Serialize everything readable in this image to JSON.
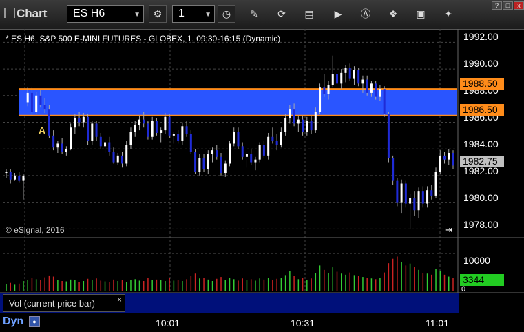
{
  "toolbar": {
    "app_title": "Chart",
    "symbol": "ES H6",
    "interval": "1"
  },
  "chart": {
    "title": "* ES H6, S&P 500 E-MINI FUTURES - GLOBEX, 1, 09:30-16:15 (Dynamic)",
    "copyright": "© eSignal, 2016",
    "marker_letter": "A",
    "price_ticks": [
      "1992.00",
      "1990.00",
      "1988.00",
      "1986.00",
      "1984.00",
      "1982.00",
      "1980.00",
      "1978.00"
    ],
    "zone_top_label": "1988.50",
    "zone_bottom_label": "1986.50",
    "last_price_label": "1982.75",
    "volume_tick": "10000",
    "volume_zero": "0",
    "last_volume_label": "3344",
    "time_labels": [
      "10:01",
      "10:31",
      "11:01"
    ],
    "colors": {
      "zone_fill": "#2a55ff",
      "zone_line": "#ff8c1a",
      "up_candle": "#ffffff",
      "down_candle": "#1f2bd6",
      "vol_up": "#33cc33",
      "vol_down": "#cc2222",
      "last_volume_tag": "#22cc22",
      "last_price_tag": "#c0c0c0"
    }
  },
  "study": {
    "label": "Vol (current price bar)"
  },
  "statusbar": {
    "dyn_label": "Dyn"
  },
  "chart_data": {
    "type": "candlestick",
    "y_range": [
      1977.5,
      1993
    ],
    "zone": [
      1986.5,
      1988.5
    ],
    "candles": [
      [
        1982.2,
        1982.5,
        1981.8,
        1982.3
      ],
      [
        1982.3,
        1982.5,
        1981.4,
        1981.7
      ],
      [
        1981.7,
        1982.2,
        1981.6,
        1982.0
      ],
      [
        1982.0,
        1982.3,
        1981.5,
        1981.6
      ],
      [
        1981.6,
        1982.1,
        1980.2,
        1982.0
      ],
      [
        1987.5,
        1988.6,
        1987.2,
        1988.2
      ],
      [
        1988.2,
        1988.6,
        1986.5,
        1986.8
      ],
      [
        1986.8,
        1988.3,
        1986.6,
        1988.0
      ],
      [
        1988.0,
        1988.4,
        1987.1,
        1987.3
      ],
      [
        1987.3,
        1987.8,
        1986.7,
        1987.0
      ],
      [
        1987.0,
        1987.3,
        1984.8,
        1985.0
      ],
      [
        1985.0,
        1985.4,
        1983.9,
        1984.1
      ],
      [
        1984.1,
        1984.6,
        1983.7,
        1984.4
      ],
      [
        1984.4,
        1984.8,
        1983.6,
        1983.8
      ],
      [
        1983.8,
        1984.2,
        1983.5,
        1984.0
      ],
      [
        1984.0,
        1985.9,
        1983.9,
        1985.6
      ],
      [
        1985.6,
        1986.6,
        1985.1,
        1986.3
      ],
      [
        1986.3,
        1986.8,
        1985.7,
        1986.0
      ],
      [
        1986.0,
        1986.7,
        1985.6,
        1986.4
      ],
      [
        1986.4,
        1986.6,
        1984.3,
        1984.6
      ],
      [
        1984.6,
        1986.1,
        1984.3,
        1985.9
      ],
      [
        1985.9,
        1986.1,
        1984.6,
        1984.9
      ],
      [
        1984.9,
        1985.2,
        1984.0,
        1984.2
      ],
      [
        1984.2,
        1984.7,
        1983.7,
        1984.5
      ],
      [
        1984.5,
        1984.9,
        1983.5,
        1983.8
      ],
      [
        1983.8,
        1984.1,
        1982.9,
        1983.0
      ],
      [
        1983.0,
        1983.7,
        1982.8,
        1983.5
      ],
      [
        1983.5,
        1983.8,
        1982.6,
        1982.9
      ],
      [
        1982.9,
        1984.6,
        1982.7,
        1984.3
      ],
      [
        1984.3,
        1985.6,
        1984.0,
        1985.3
      ],
      [
        1985.3,
        1986.1,
        1984.9,
        1985.8
      ],
      [
        1985.8,
        1986.5,
        1985.4,
        1986.2
      ],
      [
        1986.2,
        1986.8,
        1985.6,
        1985.9
      ],
      [
        1985.9,
        1986.1,
        1984.7,
        1984.9
      ],
      [
        1984.9,
        1986.4,
        1984.7,
        1986.1
      ],
      [
        1986.1,
        1986.3,
        1985.0,
        1985.2
      ],
      [
        1985.2,
        1985.6,
        1984.5,
        1985.4
      ],
      [
        1985.4,
        1986.7,
        1985.1,
        1986.4
      ],
      [
        1986.4,
        1986.6,
        1984.8,
        1985.0
      ],
      [
        1985.0,
        1985.3,
        1984.4,
        1985.1
      ],
      [
        1985.1,
        1985.4,
        1984.4,
        1984.6
      ],
      [
        1984.6,
        1986.0,
        1984.3,
        1985.7
      ],
      [
        1985.7,
        1986.1,
        1984.9,
        1985.1
      ],
      [
        1985.1,
        1985.4,
        1983.6,
        1983.8
      ],
      [
        1983.8,
        1984.0,
        1982.1,
        1982.3
      ],
      [
        1982.3,
        1983.6,
        1982.0,
        1983.3
      ],
      [
        1983.3,
        1983.6,
        1982.3,
        1982.5
      ],
      [
        1982.5,
        1983.9,
        1982.1,
        1983.6
      ],
      [
        1983.6,
        1984.1,
        1983.0,
        1983.9
      ],
      [
        1983.9,
        1984.3,
        1983.2,
        1983.4
      ],
      [
        1983.4,
        1983.7,
        1982.0,
        1982.2
      ],
      [
        1982.2,
        1983.1,
        1981.9,
        1982.9
      ],
      [
        1982.9,
        1984.6,
        1982.7,
        1984.4
      ],
      [
        1984.4,
        1985.6,
        1984.2,
        1985.3
      ],
      [
        1985.3,
        1985.6,
        1984.0,
        1984.2
      ],
      [
        1984.2,
        1984.5,
        1983.2,
        1983.4
      ],
      [
        1983.4,
        1983.8,
        1982.6,
        1983.6
      ],
      [
        1983.6,
        1984.0,
        1982.8,
        1983.0
      ],
      [
        1983.0,
        1983.4,
        1982.4,
        1983.2
      ],
      [
        1983.2,
        1984.5,
        1983.0,
        1984.3
      ],
      [
        1984.3,
        1984.6,
        1983.3,
        1983.5
      ],
      [
        1983.5,
        1985.2,
        1983.2,
        1984.9
      ],
      [
        1984.9,
        1985.6,
        1984.4,
        1984.6
      ],
      [
        1984.6,
        1985.1,
        1983.9,
        1984.3
      ],
      [
        1984.3,
        1985.6,
        1984.1,
        1985.3
      ],
      [
        1985.3,
        1986.6,
        1985.0,
        1986.3
      ],
      [
        1986.3,
        1987.3,
        1985.9,
        1987.0
      ],
      [
        1987.0,
        1987.4,
        1985.7,
        1985.9
      ],
      [
        1985.9,
        1986.5,
        1985.3,
        1986.2
      ],
      [
        1986.2,
        1986.5,
        1985.0,
        1985.3
      ],
      [
        1985.3,
        1986.4,
        1985.0,
        1986.1
      ],
      [
        1986.1,
        1986.5,
        1985.1,
        1985.4
      ],
      [
        1985.4,
        1987.1,
        1985.2,
        1986.8
      ],
      [
        1986.8,
        1988.9,
        1986.6,
        1988.6
      ],
      [
        1988.6,
        1989.6,
        1987.9,
        1988.1
      ],
      [
        1988.1,
        1989.1,
        1987.7,
        1988.8
      ],
      [
        1988.8,
        1991.0,
        1988.6,
        1989.6
      ],
      [
        1989.6,
        1990.3,
        1988.7,
        1988.9
      ],
      [
        1988.9,
        1990.0,
        1988.5,
        1989.7
      ],
      [
        1989.7,
        1990.3,
        1989.0,
        1990.1
      ],
      [
        1990.1,
        1990.4,
        1989.1,
        1989.3
      ],
      [
        1989.3,
        1990.2,
        1988.8,
        1989.9
      ],
      [
        1989.9,
        1990.1,
        1988.7,
        1988.9
      ],
      [
        1988.9,
        1989.5,
        1988.2,
        1989.2
      ],
      [
        1989.2,
        1989.5,
        1988.0,
        1988.2
      ],
      [
        1988.2,
        1989.1,
        1987.9,
        1988.9
      ],
      [
        1988.9,
        1989.1,
        1987.7,
        1987.9
      ],
      [
        1987.9,
        1988.8,
        1987.6,
        1988.5
      ],
      [
        1988.5,
        1988.7,
        1986.4,
        1986.6
      ],
      [
        1986.6,
        1986.8,
        1983.0,
        1983.3
      ],
      [
        1983.3,
        1983.5,
        1981.3,
        1981.6
      ],
      [
        1981.6,
        1981.8,
        1979.7,
        1980.0
      ],
      [
        1980.0,
        1981.7,
        1979.2,
        1981.4
      ],
      [
        1981.4,
        1981.6,
        1979.6,
        1979.9
      ],
      [
        1979.9,
        1980.6,
        1978.0,
        1980.3
      ],
      [
        1980.3,
        1980.8,
        1979.0,
        1979.4
      ],
      [
        1979.4,
        1981.1,
        1978.8,
        1980.8
      ],
      [
        1980.8,
        1981.2,
        1979.6,
        1979.9
      ],
      [
        1979.9,
        1981.2,
        1979.6,
        1980.9
      ],
      [
        1980.9,
        1981.3,
        1980.2,
        1980.5
      ],
      [
        1980.5,
        1982.6,
        1980.3,
        1982.3
      ],
      [
        1982.3,
        1983.9,
        1982.1,
        1983.5
      ],
      [
        1983.5,
        1983.8,
        1982.9,
        1983.2
      ],
      [
        1983.2,
        1984.0,
        1982.8,
        1983.7
      ],
      [
        1983.7,
        1983.9,
        1982.5,
        1982.75
      ]
    ],
    "volumes": [
      1800,
      2100,
      1600,
      1900,
      2600,
      2800,
      3400,
      3100,
      2900,
      3600,
      4100,
      3800,
      2800,
      2600,
      2500,
      3000,
      2900,
      2400,
      2600,
      3200,
      2800,
      3300,
      2700,
      2500,
      2400,
      3000,
      2600,
      2800,
      2400,
      2900,
      3100,
      2700,
      2600,
      3400,
      2800,
      3000,
      2900,
      2600,
      3500,
      2700,
      2800,
      2600,
      3100,
      3900,
      4600,
      3300,
      3500,
      3000,
      2600,
      3200,
      3700,
      2900,
      3400,
      3100,
      2700,
      3300,
      2800,
      3100,
      2700,
      3300,
      3000,
      3400,
      2900,
      3200,
      3500,
      4200,
      5200,
      3900,
      3100,
      3400,
      2900,
      3300,
      4700,
      6800,
      5600,
      4800,
      6300,
      5100,
      4600,
      4300,
      4900,
      4200,
      3900,
      3700,
      3500,
      3300,
      3100,
      3400,
      4900,
      7400,
      8600,
      9200,
      7800,
      6800,
      7300,
      6400,
      5600,
      4800,
      4600,
      4300,
      5900,
      5400,
      4300,
      3800,
      3344
    ],
    "volume_range": [
      0,
      13000
    ]
  }
}
